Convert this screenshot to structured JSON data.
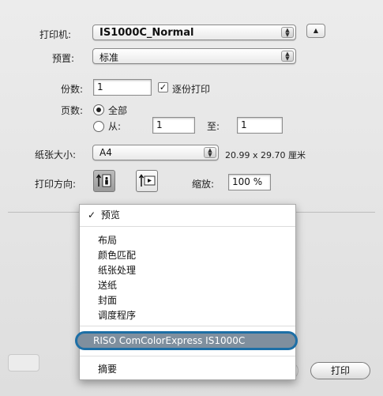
{
  "printer": {
    "label": "打印机:",
    "value": "IS1000C_Normal"
  },
  "presets": {
    "label": "预置:",
    "value": "标准"
  },
  "copies": {
    "label": "份数:",
    "value": "1",
    "collate_label": "逐份打印"
  },
  "pages": {
    "label": "页数:",
    "all_label": "全部",
    "from_label": "从:",
    "from_value": "1",
    "to_label": "至:",
    "to_value": "1"
  },
  "paper_size": {
    "label": "纸张大小:",
    "value": "A4",
    "dimensions": "20.99 x 29.70 厘米"
  },
  "orientation": {
    "label": "打印方向:",
    "scale_label": "缩放:",
    "scale_value": "100 %"
  },
  "menu": {
    "items": [
      {
        "label": "预览",
        "checked": true
      },
      {
        "label": "布局"
      },
      {
        "label": "颜色匹配"
      },
      {
        "label": "纸张处理"
      },
      {
        "label": "送纸"
      },
      {
        "label": "封面"
      },
      {
        "label": "调度程序"
      },
      {
        "label": "RISO ComColorExpress IS1000C",
        "highlighted": true
      },
      {
        "label": "摘要"
      }
    ],
    "checkmark": "✓"
  },
  "buttons": {
    "print": "打印"
  },
  "colors": {
    "highlight_ring": "#1d6fa6",
    "highlight_fill": "#7f8f9e"
  }
}
